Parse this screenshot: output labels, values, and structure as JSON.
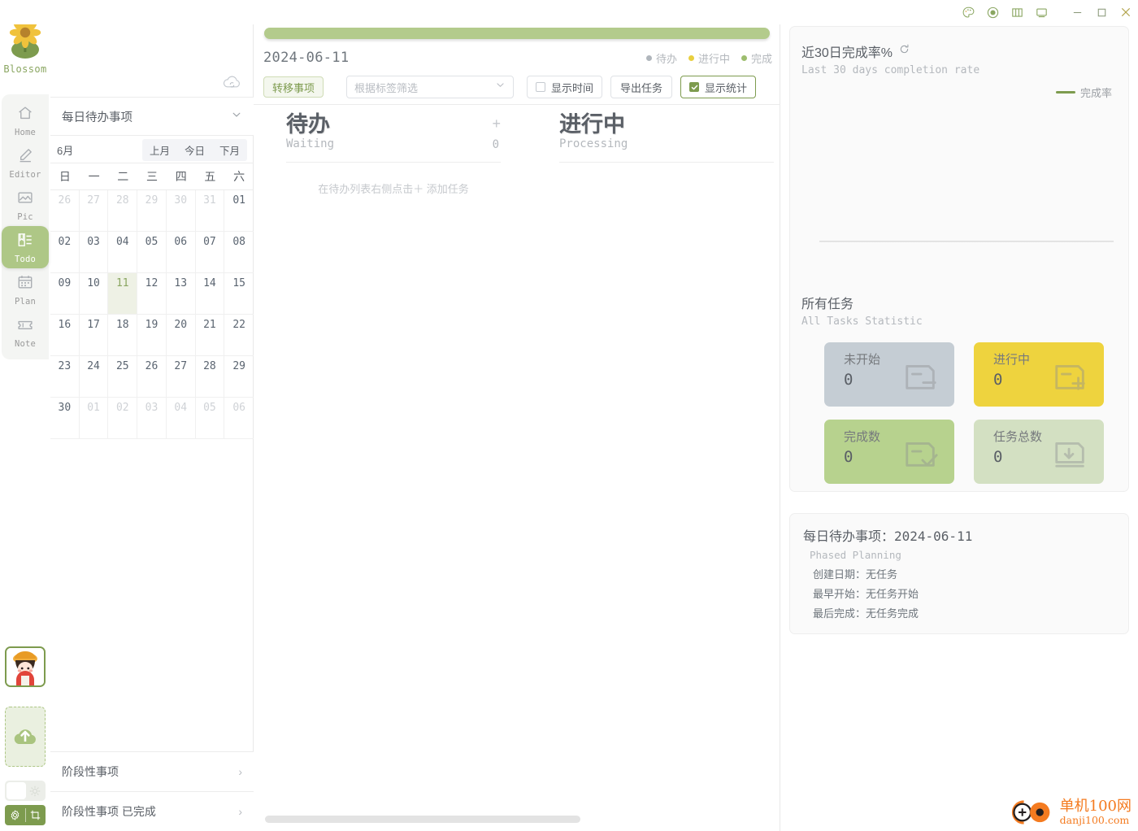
{
  "titlebar": {
    "buttons": [
      {
        "name": "palette-icon",
        "label": "palette"
      },
      {
        "name": "record-icon",
        "label": "record"
      },
      {
        "name": "columns-icon",
        "label": "columns"
      },
      {
        "name": "screen-icon",
        "label": "screen"
      }
    ],
    "minimize": "minimize",
    "maximize": "maximize",
    "close": "close"
  },
  "rail": {
    "brand": "Blossom",
    "items": [
      {
        "label": "Home",
        "icon": "home-icon",
        "active": false
      },
      {
        "label": "Editor",
        "icon": "pencil-icon",
        "active": false
      },
      {
        "label": "Pic",
        "icon": "image-icon",
        "active": false
      },
      {
        "label": "Todo",
        "icon": "todo-icon",
        "active": true
      },
      {
        "label": "Plan",
        "icon": "calendar-icon",
        "active": false
      },
      {
        "label": "Note",
        "icon": "ticket-icon",
        "active": false
      }
    ]
  },
  "left_panel": {
    "selector_value": "每日待办事项",
    "calendar": {
      "month_label": "6月",
      "nav": [
        "上月",
        "今日",
        "下月"
      ],
      "dow": [
        "日",
        "一",
        "二",
        "三",
        "四",
        "五",
        "六"
      ],
      "today": "11",
      "weeks": [
        [
          {
            "d": "26",
            "out": true
          },
          {
            "d": "27",
            "out": true
          },
          {
            "d": "28",
            "out": true
          },
          {
            "d": "29",
            "out": true
          },
          {
            "d": "30",
            "out": true
          },
          {
            "d": "31",
            "out": true
          },
          {
            "d": "01",
            "out": false
          }
        ],
        [
          {
            "d": "02",
            "out": false
          },
          {
            "d": "03",
            "out": false
          },
          {
            "d": "04",
            "out": false
          },
          {
            "d": "05",
            "out": false
          },
          {
            "d": "06",
            "out": false
          },
          {
            "d": "07",
            "out": false
          },
          {
            "d": "08",
            "out": false
          }
        ],
        [
          {
            "d": "09",
            "out": false
          },
          {
            "d": "10",
            "out": false
          },
          {
            "d": "11",
            "out": false,
            "today": true
          },
          {
            "d": "12",
            "out": false
          },
          {
            "d": "13",
            "out": false
          },
          {
            "d": "14",
            "out": false
          },
          {
            "d": "15",
            "out": false
          }
        ],
        [
          {
            "d": "16",
            "out": false
          },
          {
            "d": "17",
            "out": false
          },
          {
            "d": "18",
            "out": false
          },
          {
            "d": "19",
            "out": false
          },
          {
            "d": "20",
            "out": false
          },
          {
            "d": "21",
            "out": false
          },
          {
            "d": "22",
            "out": false
          }
        ],
        [
          {
            "d": "23",
            "out": false
          },
          {
            "d": "24",
            "out": false
          },
          {
            "d": "25",
            "out": false
          },
          {
            "d": "26",
            "out": false
          },
          {
            "d": "27",
            "out": false
          },
          {
            "d": "28",
            "out": false
          },
          {
            "d": "29",
            "out": false
          }
        ],
        [
          {
            "d": "30",
            "out": false
          },
          {
            "d": "01",
            "out": true
          },
          {
            "d": "02",
            "out": true
          },
          {
            "d": "03",
            "out": true
          },
          {
            "d": "04",
            "out": true
          },
          {
            "d": "05",
            "out": true
          },
          {
            "d": "06",
            "out": true
          }
        ]
      ]
    },
    "phase_items": [
      {
        "label": "阶段性事项"
      },
      {
        "label": "阶段性事项 已完成"
      }
    ]
  },
  "main": {
    "date": "2024-06-11",
    "legend": [
      {
        "label": "待办",
        "color": "#b0b6bc"
      },
      {
        "label": "进行中",
        "color": "#e8cf3f"
      },
      {
        "label": "完成",
        "color": "#9dbd6e"
      }
    ],
    "toolbar": {
      "transfer_label": "转移事项",
      "tag_placeholder": "根据标签筛选",
      "show_time_label": "显示时间",
      "show_time_checked": false,
      "export_label": "导出任务",
      "show_stats_label": "显示统计",
      "show_stats_checked": true
    },
    "columns": [
      {
        "title": "待办",
        "sub": "Waiting",
        "count": "0",
        "plus": "+",
        "hint": "在待办列表右侧点击＋ 添加任务"
      },
      {
        "title": "进行中",
        "sub": "Processing",
        "count": "",
        "plus": "",
        "hint": ""
      }
    ]
  },
  "right": {
    "completion": {
      "title": "近30日完成率%",
      "subtitle": "Last 30 days completion rate",
      "refresh_icon": "refresh-icon",
      "legend_label": "完成率",
      "legend_color": "#7d9b4e"
    },
    "all_tasks": {
      "title": "所有任务",
      "subtitle": "All Tasks Statistic",
      "cards": [
        {
          "label": "未开始",
          "value": "0",
          "bg": "#c5cdd4",
          "icon": "box-minus-icon"
        },
        {
          "label": "进行中",
          "value": "0",
          "bg": "#eed33e",
          "icon": "box-plus-icon"
        },
        {
          "label": "完成数",
          "value": "0",
          "bg": "#b7d28e",
          "icon": "box-check-icon"
        },
        {
          "label": "任务总数",
          "value": "0",
          "bg": "#d3e0c2",
          "icon": "box-down-icon"
        }
      ]
    },
    "info": {
      "title": "每日待办事项：2024-06-11",
      "subtitle": "Phased Planning",
      "lines": [
        "创建日期：无任务",
        "最早开始：无任务开始",
        "最后完成：无任务完成"
      ]
    }
  },
  "watermark": {
    "cn": "单机100网",
    "en": "danji100.com"
  },
  "chart_data": {
    "type": "line",
    "title": "近30日完成率%",
    "subtitle": "Last 30 days completion rate",
    "xlabel": "",
    "ylabel": "",
    "series": [
      {
        "name": "完成率",
        "color": "#7d9b4e",
        "values": []
      }
    ],
    "x": [],
    "ylim": [
      0,
      100
    ],
    "grid": false,
    "legend_position": "top-right",
    "note": "No data plotted — empty chart with baseline axis only"
  }
}
